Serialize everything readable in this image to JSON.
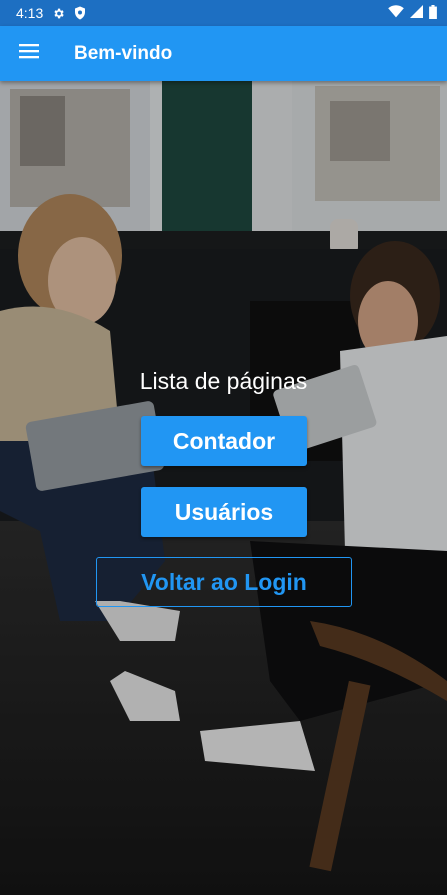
{
  "status_bar": {
    "time": "4:13",
    "icons": [
      "settings-icon",
      "shield-icon",
      "wifi-icon",
      "signal-icon",
      "battery-icon"
    ]
  },
  "app_bar": {
    "menu_icon": "menu-icon",
    "title": "Bem-vindo",
    "color": "#2196f3"
  },
  "main": {
    "heading": "Lista de páginas",
    "buttons": {
      "contador": "Contador",
      "usuarios": "Usuários",
      "voltar": "Voltar ao Login"
    }
  },
  "colors": {
    "primary": "#2196f3",
    "status_bar": "#1d6fc2"
  }
}
